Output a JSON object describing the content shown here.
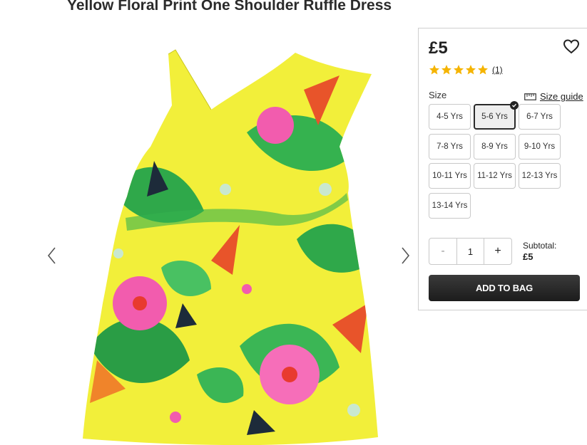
{
  "product": {
    "title": "Yellow Floral Print One Shoulder Ruffle Dress",
    "price": "£5",
    "review_count": "(1)",
    "rating": 5,
    "rating_max": 5
  },
  "size": {
    "label": "Size",
    "guide_label": "Size guide",
    "options": [
      "4-5 Yrs",
      "5-6 Yrs",
      "6-7 Yrs",
      "7-8 Yrs",
      "8-9 Yrs",
      "9-10 Yrs",
      "10-11 Yrs",
      "11-12 Yrs",
      "12-13 Yrs",
      "13-14 Yrs"
    ],
    "selected": "5-6 Yrs"
  },
  "quantity": {
    "minus": "-",
    "value": "1",
    "plus": "+"
  },
  "subtotal": {
    "label": "Subtotal:",
    "amount": "£5"
  },
  "add_to_bag_label": "ADD TO BAG",
  "colors": {
    "star": "#f5b400",
    "button_dark": "#222222",
    "dress_yellow": "#f2ef3a"
  },
  "icons": {
    "wishlist": "heart-icon",
    "size_guide": "ruler-icon",
    "prev": "chevron-left-icon",
    "next": "chevron-right-icon",
    "selected": "check-icon"
  }
}
